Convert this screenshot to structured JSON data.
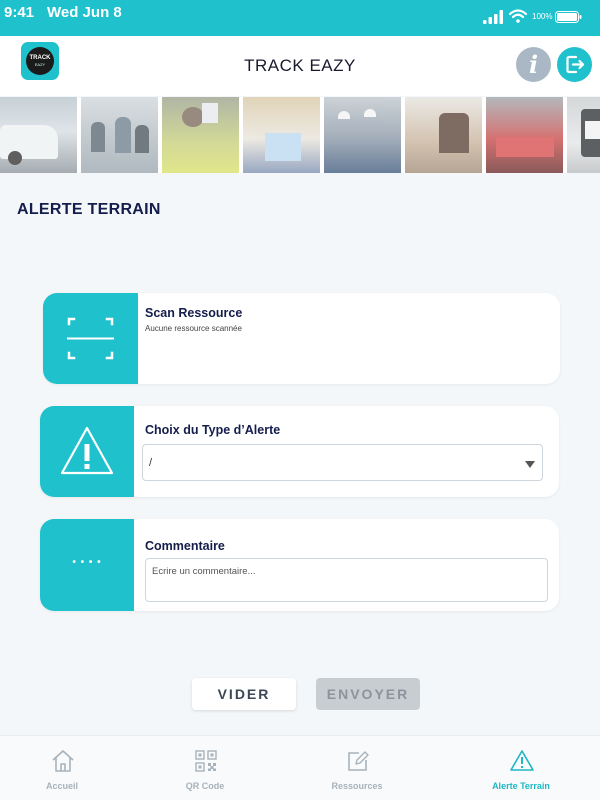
{
  "status_bar": {
    "time": "9:41",
    "date": "Wed Jun 8",
    "battery": "100%"
  },
  "header": {
    "app_title": "TRACK EAZY",
    "logo_text_main": "TRACK",
    "logo_text_sub": "EAZY",
    "info_label": "i"
  },
  "page": {
    "title": "ALERTE TERRAIN"
  },
  "scan_card": {
    "title": "Scan Ressource",
    "subtitle": "Aucune ressource scannée"
  },
  "alert_card": {
    "title": "Choix du Type d’Alerte",
    "selected_value": "/"
  },
  "comment_card": {
    "title": "Commentaire",
    "placeholder": "Ecrire un commentaire...",
    "icon_text": "• • • •"
  },
  "actions": {
    "clear_label": "VIDER",
    "send_label": "ENVOYER"
  },
  "bottom_nav": {
    "items": [
      {
        "label": "Accueil",
        "icon": "home-icon",
        "active": false
      },
      {
        "label": "QR Code",
        "icon": "qr-code-icon",
        "active": false
      },
      {
        "label": "Ressources",
        "icon": "edit-icon",
        "active": false
      },
      {
        "label": "Alerte Terrain",
        "icon": "warning-icon",
        "active": true
      }
    ]
  },
  "colors": {
    "accent": "#1fc1cc",
    "title_text": "#141d4c",
    "inactive_nav": "#a7b2bb",
    "disabled_button": "#c8cdd1"
  }
}
